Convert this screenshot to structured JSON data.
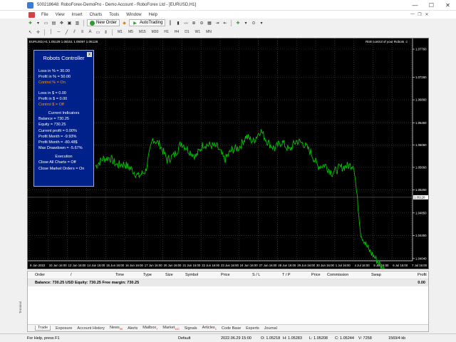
{
  "window": {
    "title": "500218648: RoboForex-DemoPro - Demo Account - RoboForex Ltd - [EURUSD,H1]",
    "controls": [
      "—",
      "☐",
      "✕"
    ]
  },
  "menu": {
    "items": [
      "File",
      "View",
      "Insert",
      "Charts",
      "Tools",
      "Window",
      "Help"
    ],
    "mdi_controls": [
      "—",
      "❐",
      "✕"
    ]
  },
  "toolbar": {
    "new_order_label": "New Order",
    "autotrading_label": "AutoTrading",
    "timeframes": [
      "M1",
      "M5",
      "M15",
      "M30",
      "H1",
      "H4",
      "D1",
      "W1",
      "MN"
    ]
  },
  "chart": {
    "header": "EURUSD,H1  1.05128 1.05151 1.05097 1.05128",
    "right_label": "Risk control of your Robots ☺",
    "last_price": "1.05128",
    "colors": {
      "background": "#000000",
      "line": "#00c000",
      "grid": "#4a4a4a",
      "text": "#ffffff"
    }
  },
  "chart_data": {
    "type": "line",
    "title": "",
    "xlabel": "",
    "ylabel": "",
    "ylim": [
      1.04,
      1.0795
    ],
    "yticks": [
      "1.07760",
      "1.07260",
      "1.06860",
      "1.06450",
      "1.06060",
      "1.05660",
      "1.05260",
      "1.04850",
      "1.04450",
      "1.04040"
    ],
    "xticks": [
      "9 Jun 2022",
      "10 Jun 16:00",
      "13 Jun 16:00",
      "14 Jun 16:00",
      "15 Jun 16:00",
      "16 Jun 16:00",
      "17 Jun 16:00",
      "20 Jun 16:00",
      "21 Jun 16:00",
      "22 Jun 16:00",
      "23 Jun 16:00",
      "24 Jun 16:00",
      "27 Jun 16:00",
      "28 Jun 16:00",
      "29 Jun 16:00",
      "30 Jun 16:00",
      "1 Jul 16:00",
      "4 Jul 16:00",
      "5 Jul 16:00",
      "6 Jul 16:00",
      "7 Jul 16:00"
    ],
    "series": [
      {
        "values": [
          1.0568,
          1.0581,
          1.0583,
          1.057,
          1.0572,
          1.0563,
          1.055,
          1.056,
          1.0617,
          1.0606,
          1.0579,
          1.0588,
          1.061,
          1.0596,
          1.0585,
          1.0607,
          1.0605,
          1.0602,
          1.0579,
          1.0597,
          1.0601,
          1.0621,
          1.0612,
          1.0632,
          1.0611,
          1.0599,
          1.0612,
          1.0596,
          1.0613,
          1.0608,
          1.0593,
          1.0568,
          1.057,
          1.0556,
          1.0565,
          1.0568,
          1.0571,
          1.0448,
          1.0421,
          1.0405,
          1.0387,
          1.0378,
          1.0355,
          1.035,
          1.032
        ]
      }
    ],
    "grid": true,
    "legend": "none"
  },
  "robots": {
    "title": "Robots Controller",
    "close": "X",
    "loss_pct": "Loss in % = 30.00",
    "profit_pct": "Profit in % = 50.00",
    "control_pct": "Control % = On",
    "loss_usd": "Loss in $ = 0.00",
    "profit_usd": "Profit in $ = 0.00",
    "control_usd": "Control $ = Off",
    "indicators_head": "Current Indicators",
    "balance": "Balance = 730.25",
    "equity": "Equity = 730.25",
    "current_profit": "Current profit = 0.00%",
    "profit_month": "Profit Month = -9.93%",
    "profit_month_usd": "Profit Month = -80.48$",
    "max_dd": "Max Drawdown = -5.67%",
    "execution_head": "Execution",
    "close_all": "Close All Charts = Off",
    "close_market": "Close Market Orders = On"
  },
  "terminal": {
    "columns": [
      "Order",
      "/",
      "Time",
      "Type",
      "Size",
      "Symbol",
      "Price",
      "S / L",
      "T / P",
      "Price",
      "Commission",
      "Swap",
      "Profit"
    ],
    "balance_line": "Balance: 730.25 USD  Equity: 730.25  Free margin: 730.25",
    "balance_profit": "0.00",
    "side_label": "Terminal",
    "tabs": [
      {
        "label": "Trade",
        "badge": ""
      },
      {
        "label": "Exposure",
        "badge": ""
      },
      {
        "label": "Account History",
        "badge": ""
      },
      {
        "label": "News",
        "badge": "99"
      },
      {
        "label": "Alerts",
        "badge": ""
      },
      {
        "label": "Mailbox",
        "badge": "7"
      },
      {
        "label": "Market",
        "badge": "110"
      },
      {
        "label": "Signals",
        "badge": ""
      },
      {
        "label": "Articles",
        "badge": "1"
      },
      {
        "label": "Code Base",
        "badge": ""
      },
      {
        "label": "Experts",
        "badge": ""
      },
      {
        "label": "Journal",
        "badge": ""
      }
    ]
  },
  "status": {
    "help": "For Help, press F1",
    "profile": "Default",
    "datetime": "2022.06.29 15:00",
    "open": "O: 1.05218",
    "high": "H: 1.05283",
    "low": "L: 1.05208",
    "close": "C: 1.05244",
    "volume": "V: 7258",
    "traffic": "1569/4 kb"
  }
}
